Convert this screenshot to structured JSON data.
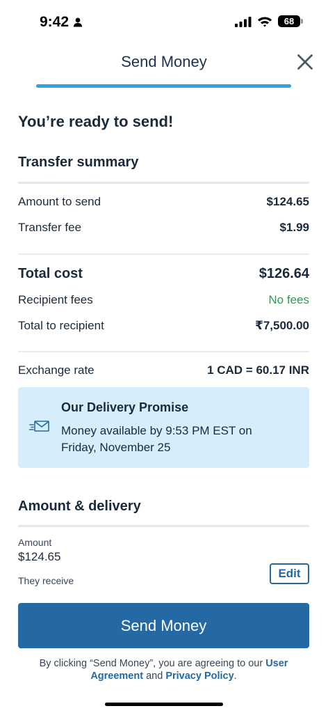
{
  "status_bar": {
    "time": "9:42",
    "battery": "68"
  },
  "header": {
    "title": "Send Money"
  },
  "ready_message": "You’re ready to send!",
  "summary": {
    "title": "Transfer summary",
    "amount_to_send_label": "Amount to send",
    "amount_to_send_value": "$124.65",
    "transfer_fee_label": "Transfer fee",
    "transfer_fee_value": "$1.99",
    "total_cost_label": "Total cost",
    "total_cost_value": "$126.64",
    "recipient_fees_label": "Recipient fees",
    "recipient_fees_value": "No fees",
    "total_to_recipient_label": "Total to recipient",
    "total_to_recipient_value": "₹7,500.00",
    "exchange_rate_label": "Exchange rate",
    "exchange_rate_value": "1 CAD = 60.17 INR"
  },
  "promise": {
    "title": "Our Delivery Promise",
    "body": "Money available by 9:53 PM EST on Friday, November 25"
  },
  "delivery": {
    "title": "Amount & delivery",
    "amount_label": "Amount",
    "amount_value": "$124.65",
    "they_receive_label": "They receive",
    "edit_label": "Edit"
  },
  "cta": {
    "label": "Send Money"
  },
  "legal": {
    "prefix": "By clicking “Send Money”, you are agreeing to our ",
    "user_agreement": "User Agreement",
    "and": " and ",
    "privacy_policy": "Privacy Policy",
    "suffix": "."
  },
  "colors": {
    "accent": "#2469a3",
    "progress": "#2ba3dc",
    "promise_bg": "#d6eefb",
    "success": "#2e9a56"
  },
  "icons": {
    "close": "close-icon",
    "envelope": "send-envelope-icon"
  }
}
